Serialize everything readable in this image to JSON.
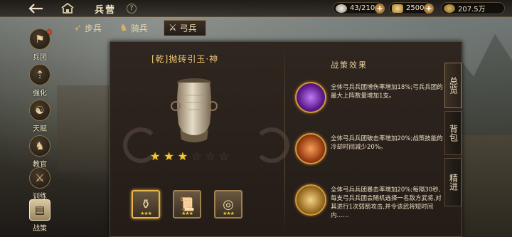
{
  "header": {
    "title": "兵营",
    "help": "?",
    "back_icon": "back-arrow-icon",
    "home_icon": "camp-icon"
  },
  "resources": {
    "troops": "43/210",
    "grain": "2500",
    "silver": "207.5万",
    "plus": "+"
  },
  "sidebar": {
    "items": [
      {
        "label": "兵团",
        "icon": "legion-icon",
        "glyph": "⚑"
      },
      {
        "label": "强化",
        "icon": "upgrade-icon",
        "glyph": "⇡"
      },
      {
        "label": "天赋",
        "icon": "talent-icon",
        "glyph": "☯"
      },
      {
        "label": "教官",
        "icon": "instructor-icon",
        "glyph": "♞"
      },
      {
        "label": "训练",
        "icon": "training-icon",
        "glyph": "⚔"
      },
      {
        "label": "战策",
        "icon": "strategy-book-icon",
        "glyph": "▤"
      }
    ]
  },
  "tabs": {
    "infantry": "步兵",
    "cavalry": "骑兵",
    "archer": "弓兵"
  },
  "item": {
    "name": "[乾]抛砖引玉·神",
    "stars_filled": 3,
    "stars_total": 6
  },
  "thumbnails": [
    {
      "icon": "jar-icon",
      "glyph": "⚱",
      "stars": "★★★"
    },
    {
      "icon": "scroll-icon",
      "glyph": "📜",
      "stars": "★★★"
    },
    {
      "icon": "disc-icon",
      "glyph": "◎",
      "stars": "★★★"
    }
  ],
  "effects": {
    "title": "战策效果",
    "items": [
      {
        "icon": "archer-purple-icon",
        "text": "全体弓兵兵团增伤率增加18%;弓兵兵团的最大上阵数量增加1支。"
      },
      {
        "icon": "bow-fire-icon",
        "text": "全体弓兵兵团破击率增加20%;战策技能的冷却时间减少20%。"
      },
      {
        "icon": "archer-gold-icon",
        "text": "全体弓兵兵团暴击率增加20%;每隔30秒,每支弓兵兵团会随机选择一名敌方武将,对其进行1次弱箭攻击,并令该武将短时间内……"
      }
    ]
  },
  "right_tabs": {
    "overview": "总览",
    "bag": "背包",
    "refine": "精进"
  },
  "colors": {
    "gold": "#f4c935",
    "title_gold": "#f0c775",
    "panel": "#2f2620"
  }
}
